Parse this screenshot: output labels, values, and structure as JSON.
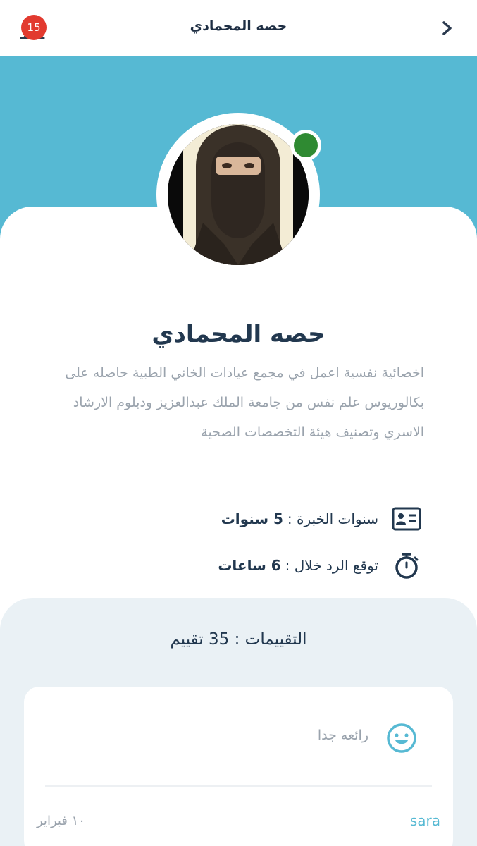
{
  "header": {
    "title": "حصه المحمادي",
    "notification_count": "15",
    "back_icon": "chevron-right-icon",
    "bell_icon": "bell-icon"
  },
  "profile": {
    "name": "حصه المحمادي",
    "bio": "اخصائية نفسية اعمل في مجمع عيادات الخاني الطبية حاصله على بكالوريوس علم نفس من جامعة الملك عبدالعزيز ودبلوم الارشاد الاسري وتصنيف هيئة التخصصات الصحية",
    "online": true,
    "status_color": "#2f8a32"
  },
  "info": {
    "experience_label": "سنوات الخبرة :",
    "experience_value": "5 سنوات",
    "response_label": "توقع الرد خلال :",
    "response_value": "6 ساعات"
  },
  "reviews": {
    "title": "التقييمات : 35 تقييم",
    "items": [
      {
        "text": "رائعه جدا",
        "author": "sara",
        "date": "١٠ فبراير"
      }
    ]
  },
  "colors": {
    "accent": "#56b9d3",
    "primary_text": "#22384f",
    "badge": "#e23a2f"
  }
}
